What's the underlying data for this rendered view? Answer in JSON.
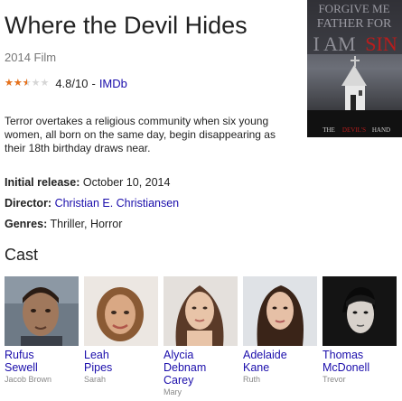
{
  "title": "Where the Devil Hides",
  "subtitle": "2014 Film",
  "rating": {
    "stars_filled": 2.5,
    "stars_total": 5,
    "score": "4.8/10",
    "separator": "-",
    "source": "IMDb"
  },
  "poster": {
    "title_text": "FORGIVE ME FATHER FOR I AM SIN",
    "tagline": "THE DEVIL'S HAND"
  },
  "description": "Terror overtakes a religious community when six young women, all born on the same day, begin disappearing as their 18th birthday draws near.",
  "facts": {
    "release_label": "Initial release:",
    "release_value": "October 10, 2014",
    "director_label": "Director:",
    "director_value": "Christian E. Christiansen",
    "genres_label": "Genres:",
    "genres_value": "Thriller, Horror"
  },
  "cast_heading": "Cast",
  "cast": [
    {
      "name": "Rufus Sewell",
      "role": "Jacob Brown"
    },
    {
      "name": "Leah Pipes",
      "role": "Sarah"
    },
    {
      "name": "Alycia Debnam Carey",
      "role": "Mary"
    },
    {
      "name": "Adelaide Kane",
      "role": "Ruth"
    },
    {
      "name": "Thomas McDonell",
      "role": "Trevor"
    }
  ],
  "colors": {
    "link": "#1a0dab",
    "star": "#e7711b",
    "muted": "#777777"
  }
}
